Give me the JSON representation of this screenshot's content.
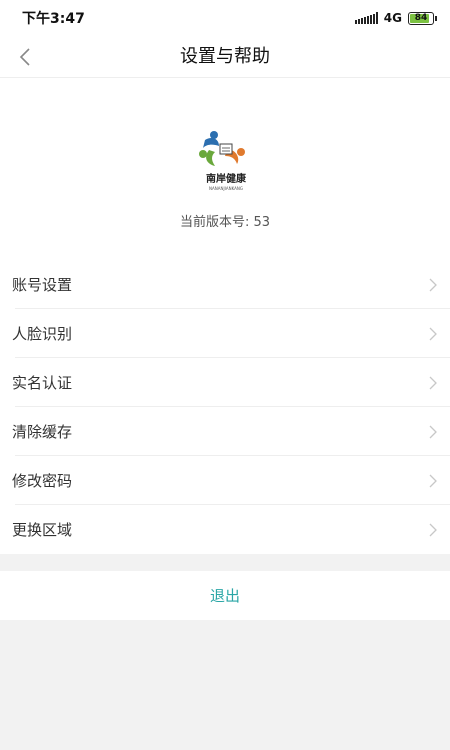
{
  "status_bar": {
    "time": "下午3:47",
    "network": "4G",
    "battery": "84"
  },
  "nav": {
    "title": "设置与帮助",
    "back_icon": "chevron-left-icon"
  },
  "app_info": {
    "logo_text": "南岸健康",
    "logo_subtext": "NANANJIANKANG",
    "version_label": "当前版本号",
    "version_sep": ": ",
    "version_value": "53"
  },
  "menu": {
    "items": [
      {
        "label": "账号设置"
      },
      {
        "label": "人脸识别"
      },
      {
        "label": "实名认证"
      },
      {
        "label": "清除缓存"
      },
      {
        "label": "修改密码"
      },
      {
        "label": "更换区域"
      }
    ]
  },
  "logout": {
    "label": "退出"
  },
  "colors": {
    "accent": "#2aa6a6",
    "battery": "#7cc242",
    "background": "#f2f2f2"
  }
}
